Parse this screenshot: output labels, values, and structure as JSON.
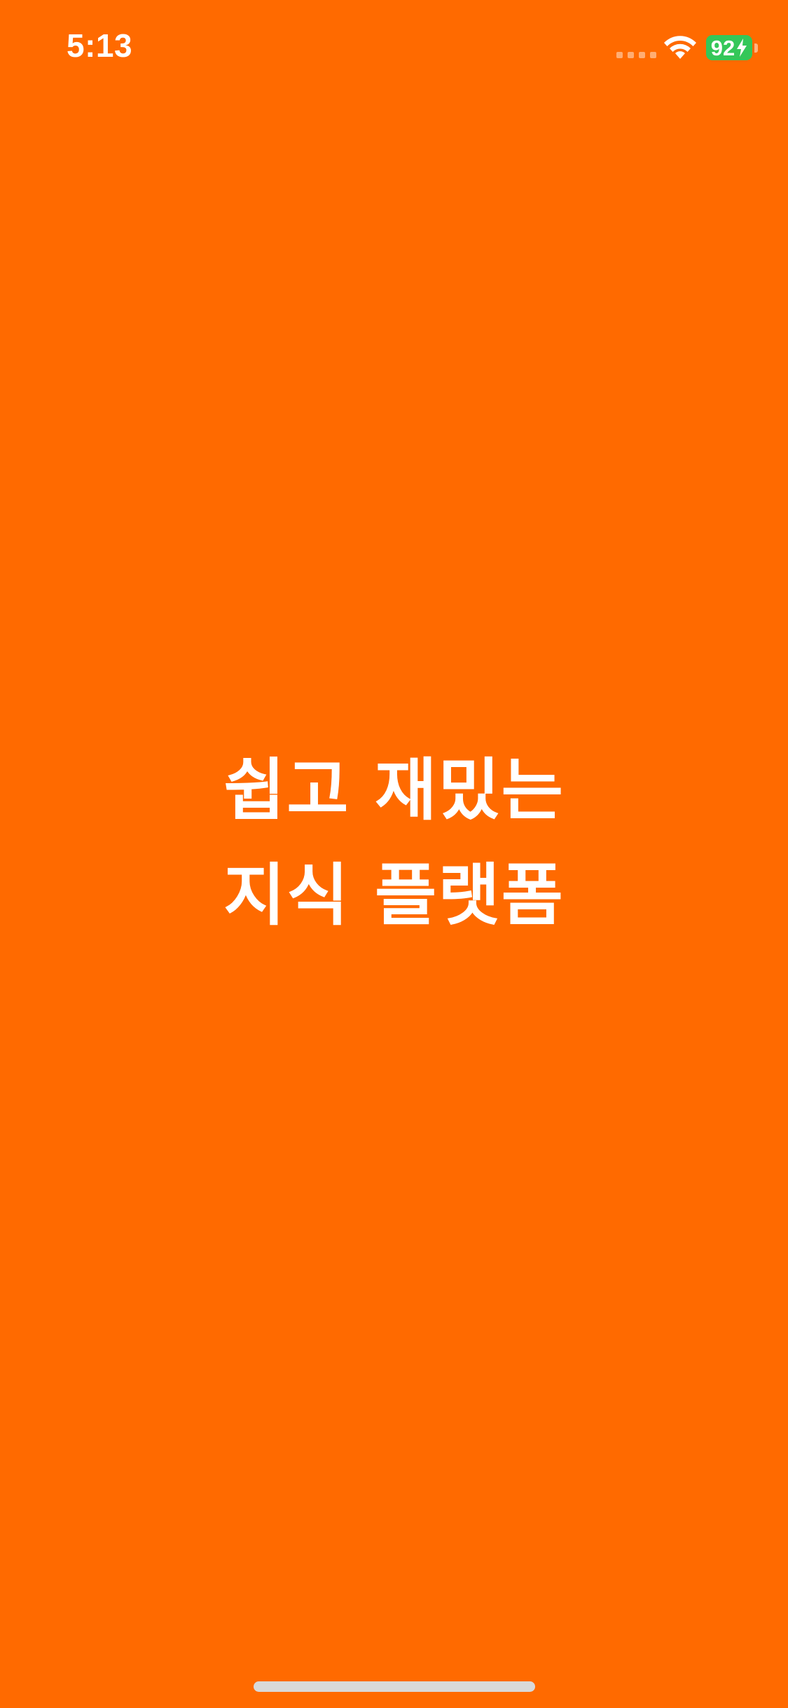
{
  "status_bar": {
    "time": "5:13",
    "battery_level": "92",
    "battery_color": "#34C759",
    "icons": [
      "cellular-signal-icon",
      "wifi-icon",
      "battery-icon",
      "charging-bolt-icon"
    ]
  },
  "splash": {
    "background_color": "#FF6A00",
    "tagline_line1": "쉽고 재밌는",
    "tagline_line2": "지식 플랫폼"
  }
}
